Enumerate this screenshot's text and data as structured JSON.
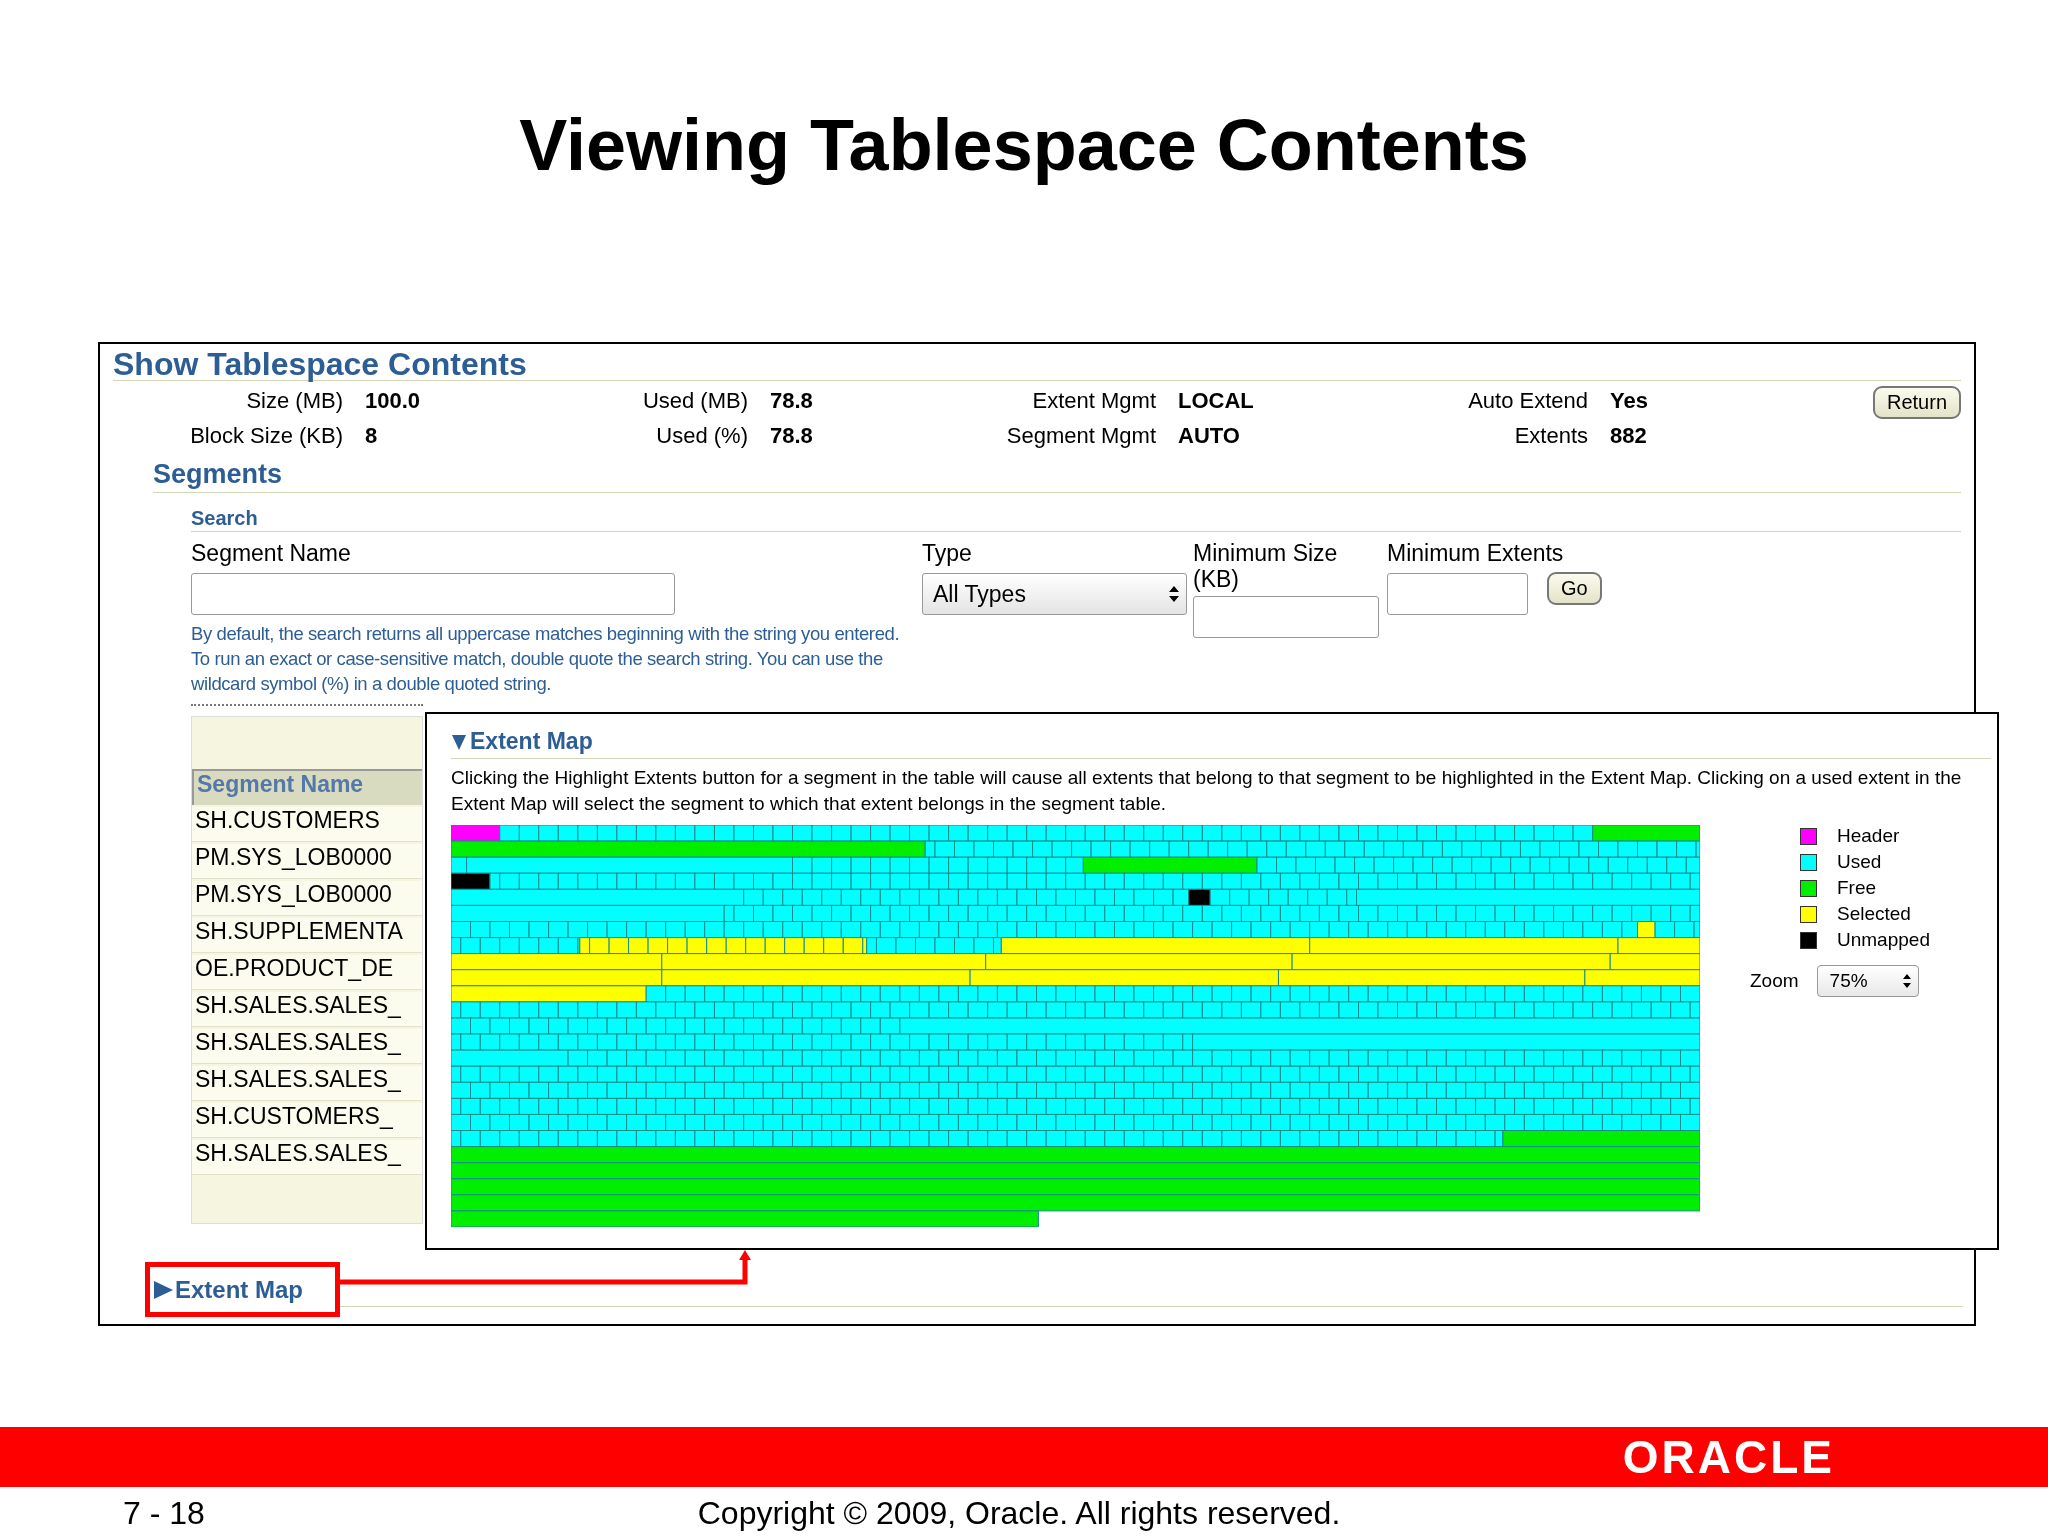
{
  "slide_title": "Viewing Tablespace Contents",
  "panel": {
    "title": "Show Tablespace Contents",
    "info": [
      {
        "label": "Size (MB)",
        "value": "100.0"
      },
      {
        "label": "Used (MB)",
        "value": "78.8"
      },
      {
        "label": "Extent Mgmt",
        "value": "LOCAL"
      },
      {
        "label": "Auto Extend",
        "value": "Yes"
      },
      {
        "label": "Block Size (KB)",
        "value": "8"
      },
      {
        "label": "Used (%)",
        "value": "78.8"
      },
      {
        "label": "Segment Mgmt",
        "value": "AUTO"
      },
      {
        "label": "Extents",
        "value": "882"
      }
    ],
    "return_button": "Return"
  },
  "segments": {
    "title": "Segments",
    "search": {
      "title": "Search",
      "segment_name_label": "Segment Name",
      "help": "By default, the search returns all uppercase matches beginning with the string you entered. To run an exact or case-sensitive match, double quote the search string. You can use the wildcard symbol (%) in a double quoted string.",
      "type_label": "Type",
      "type_value": "All Types",
      "min_size_label": "Minimum Size (KB)",
      "min_extents_label": "Minimum Extents",
      "go_button": "Go"
    },
    "table": {
      "columns": [
        "Segment Name"
      ],
      "rows": [
        "SH.CUSTOMERS",
        "PM.SYS_LOB0000",
        "PM.SYS_LOB0000",
        "SH.SUPPLEMENTA",
        "OE.PRODUCT_DE",
        "SH.SALES.SALES_",
        "SH.SALES.SALES_",
        "SH.SALES.SALES_",
        "SH.CUSTOMERS_",
        "SH.SALES.SALES_"
      ]
    }
  },
  "extent_map_popup": {
    "title": "Extent Map",
    "expanded": true,
    "description": "Clicking the Highlight Extents button for a segment in the table will cause all extents that belong to that segment to be highlighted in the Extent Map. Clicking on a used extent in the Extent Map will select the segment to which that extent belongs in the segment table.",
    "legend": [
      {
        "label": "Header",
        "color": "#ff00ff"
      },
      {
        "label": "Used",
        "color": "#00ffff"
      },
      {
        "label": "Free",
        "color": "#00ee00"
      },
      {
        "label": "Selected",
        "color": "#ffff00"
      },
      {
        "label": "Unmapped",
        "color": "#000000"
      }
    ],
    "zoom_label": "Zoom",
    "zoom_value": "75%"
  },
  "extent_map_link": {
    "label": "Extent Map",
    "expanded": false
  },
  "footer": {
    "logo": "ORACLE",
    "page": "7 - 18",
    "copyright": "Copyright © 2009, Oracle. All rights reserved."
  }
}
